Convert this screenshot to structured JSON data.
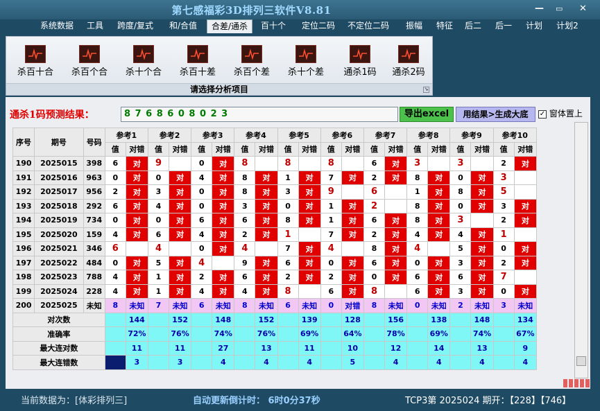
{
  "window": {
    "title": "第七感福彩3D排列三软件V8.81",
    "min": "—",
    "max": "▭",
    "close": "✕"
  },
  "menu": [
    {
      "label": "系统数据",
      "active": false
    },
    {
      "label": "工具",
      "active": false
    },
    {
      "label": "跨度/复式",
      "active": false
    },
    {
      "label": "和/合值",
      "active": false
    },
    {
      "label": "合差/通杀",
      "active": true
    },
    {
      "label": "百十个",
      "active": false
    },
    {
      "label": "定位二码",
      "active": false
    },
    {
      "label": "不定位二码",
      "active": false
    },
    {
      "label": "振幅",
      "active": false
    },
    {
      "label": "特征",
      "active": false
    },
    {
      "label": "后二",
      "active": false
    },
    {
      "label": "后一",
      "active": false
    },
    {
      "label": "计划",
      "active": false
    },
    {
      "label": "计划2",
      "active": false
    }
  ],
  "ribbon": {
    "items": [
      "杀百十合",
      "杀百个合",
      "杀十个合",
      "杀百十差",
      "杀百个差",
      "杀十个差",
      "通杀1码",
      "通杀2码"
    ],
    "footer": "请选择分析项目"
  },
  "prediction": {
    "label": "通杀1码预测结果：",
    "value": "8 7 6 8 6 0 8 0 2 3",
    "excel_button": "导出excel",
    "generate_button": "用结果>生成大底",
    "topmost_label": "窗体置上",
    "topmost_checked": true
  },
  "table": {
    "headers": {
      "seq": "序号",
      "period": "期号",
      "code": "号码",
      "value": "值",
      "judge": "对错"
    },
    "ref_headers": [
      "参考1",
      "参考2",
      "参考3",
      "参考4",
      "参考5",
      "参考6",
      "参考7",
      "参考8",
      "参考9",
      "参考10"
    ],
    "rows": [
      {
        "seq": "190",
        "period": "2025015",
        "code": "398",
        "cells": [
          [
            "6",
            "对"
          ],
          [
            "9",
            ""
          ],
          [
            "0",
            "对"
          ],
          [
            "8",
            ""
          ],
          [
            "8",
            ""
          ],
          [
            "8",
            ""
          ],
          [
            "6",
            "对"
          ],
          [
            "3",
            ""
          ],
          [
            "3",
            ""
          ],
          [
            "2",
            "对"
          ]
        ]
      },
      {
        "seq": "191",
        "period": "2025016",
        "code": "963",
        "cells": [
          [
            "0",
            "对"
          ],
          [
            "0",
            "对"
          ],
          [
            "4",
            "对"
          ],
          [
            "8",
            "对"
          ],
          [
            "1",
            "对"
          ],
          [
            "7",
            "对"
          ],
          [
            "2",
            "对"
          ],
          [
            "8",
            "对"
          ],
          [
            "0",
            "对"
          ],
          [
            "3",
            ""
          ]
        ]
      },
      {
        "seq": "192",
        "period": "2025017",
        "code": "956",
        "cells": [
          [
            "2",
            "对"
          ],
          [
            "3",
            "对"
          ],
          [
            "0",
            "对"
          ],
          [
            "8",
            "对"
          ],
          [
            "3",
            "对"
          ],
          [
            "9",
            ""
          ],
          [
            "6",
            ""
          ],
          [
            "1",
            "对"
          ],
          [
            "8",
            "对"
          ],
          [
            "5",
            ""
          ]
        ]
      },
      {
        "seq": "193",
        "period": "2025018",
        "code": "292",
        "cells": [
          [
            "6",
            "对"
          ],
          [
            "4",
            "对"
          ],
          [
            "0",
            "对"
          ],
          [
            "3",
            "对"
          ],
          [
            "0",
            "对"
          ],
          [
            "1",
            "对"
          ],
          [
            "2",
            ""
          ],
          [
            "8",
            "对"
          ],
          [
            "0",
            "对"
          ],
          [
            "3",
            "对"
          ]
        ]
      },
      {
        "seq": "194",
        "period": "2025019",
        "code": "734",
        "cells": [
          [
            "0",
            "对"
          ],
          [
            "0",
            "对"
          ],
          [
            "6",
            "对"
          ],
          [
            "6",
            "对"
          ],
          [
            "8",
            "对"
          ],
          [
            "1",
            "对"
          ],
          [
            "6",
            "对"
          ],
          [
            "8",
            "对"
          ],
          [
            "3",
            ""
          ],
          [
            "2",
            "对"
          ]
        ]
      },
      {
        "seq": "195",
        "period": "2025020",
        "code": "159",
        "cells": [
          [
            "4",
            "对"
          ],
          [
            "6",
            "对"
          ],
          [
            "4",
            "对"
          ],
          [
            "2",
            "对"
          ],
          [
            "1",
            ""
          ],
          [
            "7",
            "对"
          ],
          [
            "2",
            "对"
          ],
          [
            "4",
            "对"
          ],
          [
            "4",
            "对"
          ],
          [
            "1",
            ""
          ]
        ]
      },
      {
        "seq": "196",
        "period": "2025021",
        "code": "346",
        "cells": [
          [
            "6",
            ""
          ],
          [
            "4",
            ""
          ],
          [
            "0",
            "对"
          ],
          [
            "4",
            ""
          ],
          [
            "7",
            "对"
          ],
          [
            "4",
            ""
          ],
          [
            "8",
            "对"
          ],
          [
            "4",
            ""
          ],
          [
            "5",
            "对"
          ],
          [
            "0",
            "对"
          ]
        ]
      },
      {
        "seq": "197",
        "period": "2025022",
        "code": "484",
        "cells": [
          [
            "0",
            "对"
          ],
          [
            "5",
            "对"
          ],
          [
            "4",
            ""
          ],
          [
            "9",
            "对"
          ],
          [
            "6",
            "对"
          ],
          [
            "0",
            "对"
          ],
          [
            "6",
            "对"
          ],
          [
            "0",
            "对"
          ],
          [
            "3",
            "对"
          ],
          [
            "2",
            "对"
          ]
        ]
      },
      {
        "seq": "198",
        "period": "2025023",
        "code": "788",
        "cells": [
          [
            "4",
            "对"
          ],
          [
            "1",
            "对"
          ],
          [
            "2",
            "对"
          ],
          [
            "6",
            "对"
          ],
          [
            "2",
            "对"
          ],
          [
            "2",
            "对"
          ],
          [
            "0",
            "对"
          ],
          [
            "6",
            "对"
          ],
          [
            "6",
            "对"
          ],
          [
            "7",
            ""
          ]
        ]
      },
      {
        "seq": "199",
        "period": "2025024",
        "code": "228",
        "cells": [
          [
            "4",
            "对"
          ],
          [
            "1",
            "对"
          ],
          [
            "4",
            "对"
          ],
          [
            "4",
            "对"
          ],
          [
            "8",
            ""
          ],
          [
            "6",
            "对"
          ],
          [
            "8",
            ""
          ],
          [
            "6",
            "对"
          ],
          [
            "3",
            "对"
          ],
          [
            "0",
            "对"
          ]
        ]
      }
    ],
    "pending": {
      "seq": "200",
      "period": "2025025",
      "code": "未知",
      "cells": [
        [
          "8",
          "未知"
        ],
        [
          "7",
          "未知"
        ],
        [
          "6",
          "未知"
        ],
        [
          "8",
          "未知"
        ],
        [
          "6",
          "未知"
        ],
        [
          "0",
          "对错"
        ],
        [
          "8",
          "未知"
        ],
        [
          "0",
          "未知"
        ],
        [
          "2",
          "未知"
        ],
        [
          "3",
          "未知"
        ]
      ]
    },
    "stats": [
      {
        "label": "对次数",
        "values": [
          "144",
          "152",
          "148",
          "152",
          "139",
          "128",
          "156",
          "138",
          "148",
          "134"
        ]
      },
      {
        "label": "准确率",
        "values": [
          "72%",
          "76%",
          "74%",
          "76%",
          "69%",
          "64%",
          "78%",
          "69%",
          "74%",
          "67%"
        ]
      },
      {
        "label": "最大连对数",
        "values": [
          "11",
          "11",
          "27",
          "13",
          "11",
          "10",
          "12",
          "14",
          "13",
          "9"
        ]
      },
      {
        "label": "最大连错数",
        "values": [
          "3",
          "3",
          "4",
          "4",
          "4",
          "5",
          "4",
          "4",
          "4",
          "4"
        ]
      }
    ]
  },
  "status": {
    "current_data": "当前数据为：[体彩排列三]",
    "countdown": "自动更新倒计时：  6时0分37秒",
    "draw_info": "TCP3第 2025024 期开：【228】【746】"
  },
  "colors": {
    "hit": "#e00000",
    "stat_bg": "#7ff7f7",
    "pending_bg": "#f3c7f3"
  }
}
